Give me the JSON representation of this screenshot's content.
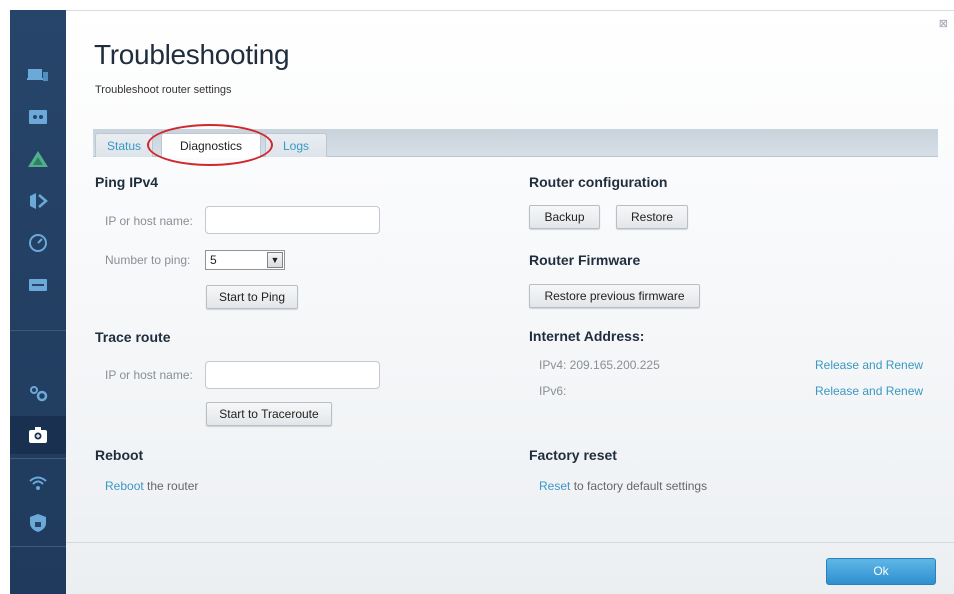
{
  "header": {
    "title": "Troubleshooting",
    "subtitle": "Troubleshoot router settings",
    "close_glyph": "⊠"
  },
  "tabs": [
    {
      "label": "Status",
      "active": false
    },
    {
      "label": "Diagnostics",
      "active": true
    },
    {
      "label": "Logs",
      "active": false
    }
  ],
  "ping": {
    "heading": "Ping IPv4",
    "host_label": "IP or host name:",
    "host_value": "",
    "count_label": "Number to ping:",
    "count_value": "5",
    "button": "Start to Ping"
  },
  "trace": {
    "heading": "Trace route",
    "host_label": "IP or host name:",
    "host_value": "",
    "button": "Start to Traceroute"
  },
  "reboot": {
    "heading": "Reboot",
    "link": "Reboot",
    "text": " the router"
  },
  "router_config": {
    "heading": "Router configuration",
    "backup": "Backup",
    "restore": "Restore"
  },
  "firmware": {
    "heading": "Router Firmware",
    "button": "Restore previous firmware"
  },
  "internet": {
    "heading": "Internet Address:",
    "ipv4": "IPv4: 209.165.200.225",
    "ipv6": "IPv6:",
    "ipv4_action": "Release and Renew",
    "ipv6_action": "Release and Renew"
  },
  "factory": {
    "heading": "Factory reset",
    "link": "Reset",
    "text": " to factory default settings"
  },
  "footer": {
    "ok": "Ok"
  },
  "sidebar_icons": [
    "devices-icon",
    "guest-access-icon",
    "network-map-icon",
    "media-prioritization-icon",
    "speed-test-icon",
    "usb-storage-icon",
    "settings-icon",
    "troubleshooting-icon",
    "wireless-icon",
    "security-icon"
  ],
  "colors": {
    "sidebar": "#27456a",
    "link": "#3a98c4",
    "highlight": "#d0282e",
    "ok_button": "#2f8fcf"
  }
}
